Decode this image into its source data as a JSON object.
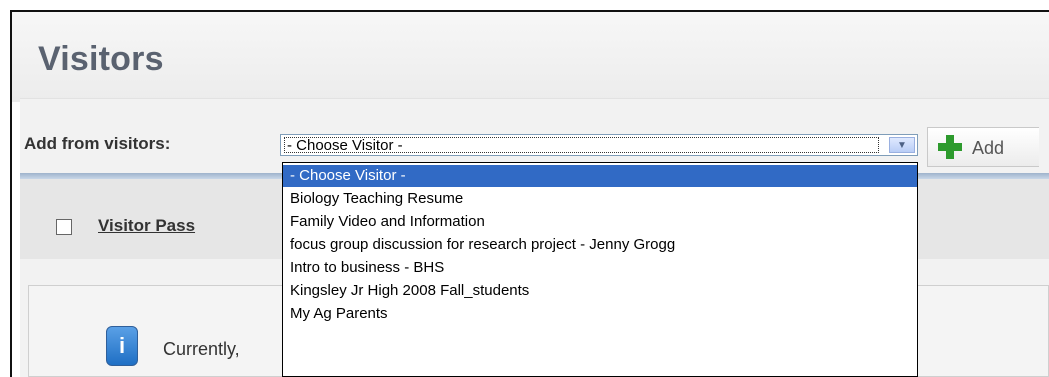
{
  "page": {
    "title": "Visitors"
  },
  "add_from": {
    "label": "Add from visitors:",
    "selected": "- Choose Visitor -",
    "add_button_label": "Add",
    "options": [
      "- Choose Visitor -",
      "Biology Teaching Resume",
      "Family Video and Information",
      "focus group discussion for research project - Jenny Grogg",
      "Intro to business - BHS",
      "Kingsley Jr High 2008 Fall_students",
      "My Ag Parents"
    ],
    "highlighted_index": 0
  },
  "table": {
    "column_visitor_pass": "Visitor Pass"
  },
  "info": {
    "text": "Currently,"
  },
  "icons": {
    "add": "plus-icon",
    "dropdown": "chevron-down-icon",
    "info": "info-icon"
  },
  "colors": {
    "selection": "#316ac5",
    "plus": "#2d9a2d",
    "title": "#5a6270"
  }
}
